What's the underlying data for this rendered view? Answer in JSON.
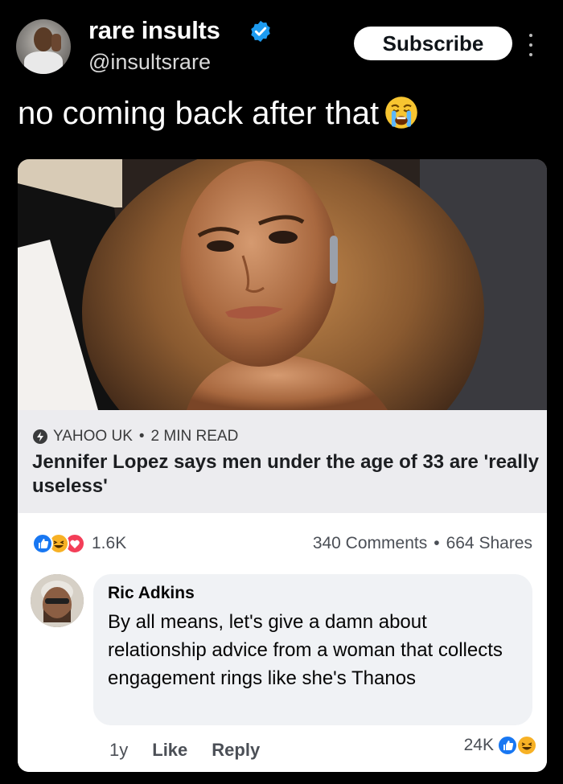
{
  "account": {
    "name": "rare insults",
    "handle": "@insultsrare",
    "subscribe_label": "Subscribe"
  },
  "post": {
    "text": "no coming back after that",
    "emoji": "crying-face-emoji"
  },
  "article": {
    "source": "YAHOO UK",
    "read_time": "2 MIN READ",
    "headline": "Jennifer Lopez says men under the age of 33 are 'really useless'"
  },
  "stats": {
    "reactions_count": "1.6K",
    "comments": "340 Comments",
    "shares": "664 Shares",
    "separator": "•"
  },
  "comment": {
    "author": "Ric Adkins",
    "text": "By all means,  let's give a damn about relationship advice from a woman that collects engagement rings like she's Thanos",
    "age": "1y",
    "like_label": "Like",
    "reply_label": "Reply",
    "reactions_count": "24K"
  },
  "colors": {
    "background": "#000000",
    "verified": "#1d9bf0",
    "fb_like": "#1877f2",
    "fb_haha": "#f7b125",
    "fb_love": "#f33e58"
  }
}
